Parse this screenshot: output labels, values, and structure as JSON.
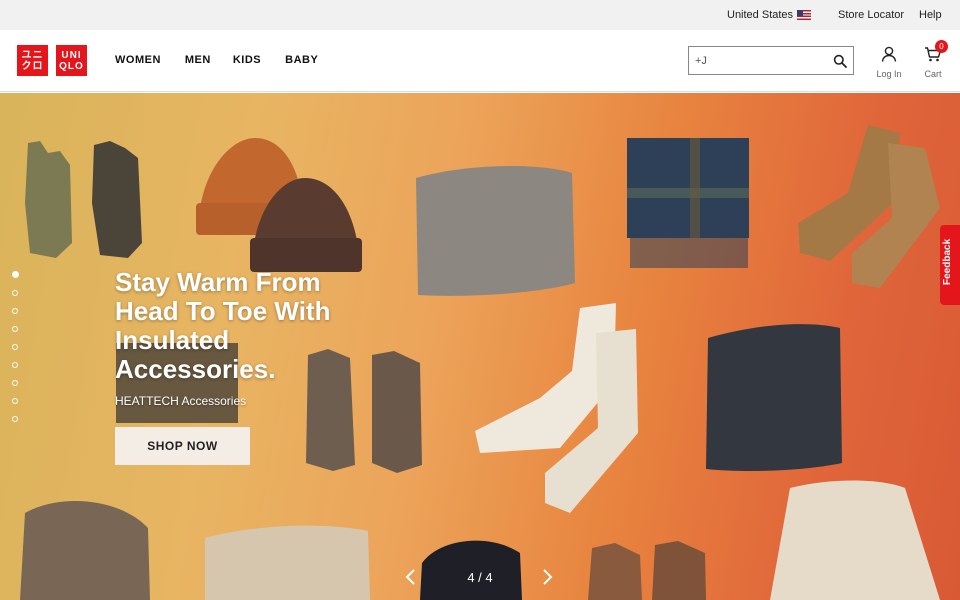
{
  "utility": {
    "country": "United States",
    "store_locator": "Store Locator",
    "help": "Help"
  },
  "logo": {
    "line1": "ユニ",
    "line1b": "クロ",
    "line2": "UNI",
    "line2b": "QLO"
  },
  "nav": {
    "items": [
      {
        "label": "WOMEN"
      },
      {
        "label": "MEN"
      },
      {
        "label": "KIDS"
      },
      {
        "label": "BABY"
      }
    ]
  },
  "search": {
    "value": "+J",
    "placeholder": ""
  },
  "account": {
    "login_label": "Log In",
    "cart_label": "Cart",
    "cart_count": "0"
  },
  "hero": {
    "headline": "Stay Warm From Head To Toe With Insulated Accessories.",
    "subline": "HEATTECH Accessories",
    "cta": "SHOP NOW",
    "slide_counter": "4 / 4",
    "dots_count": 9,
    "active_dot": 1
  },
  "feedback": {
    "label": "Feedback"
  },
  "colors": {
    "brand_red": "#e4161b",
    "utility_bg": "#f1f1f1",
    "cta_bg": "#f3ede6"
  }
}
